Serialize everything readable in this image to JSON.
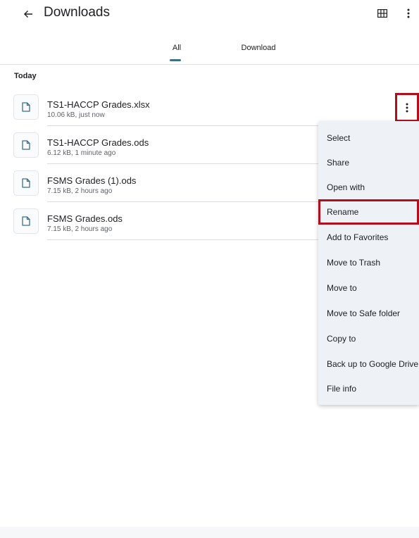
{
  "appbar": {
    "title": "Downloads",
    "back_icon": "arrow-left-icon",
    "grid_icon": "grid-view-icon",
    "more_icon": "more-vert-icon"
  },
  "tabs": [
    {
      "label": "All",
      "selected": true
    },
    {
      "label": "Download",
      "selected": false
    }
  ],
  "section": {
    "label": "Today"
  },
  "files": [
    {
      "name": "TS1-HACCP Grades.xlsx",
      "meta": "10.06 kB, just now"
    },
    {
      "name": "TS1-HACCP Grades.ods",
      "meta": "6.12 kB, 1 minute ago"
    },
    {
      "name": "FSMS Grades (1).ods",
      "meta": "7.15 kB, 2 hours ago"
    },
    {
      "name": "FSMS Grades.ods",
      "meta": "7.15 kB, 2 hours ago"
    }
  ],
  "context_menu": {
    "items": [
      {
        "label": "Select"
      },
      {
        "label": "Share"
      },
      {
        "label": "Open with"
      },
      {
        "label": "Rename",
        "highlighted": true
      },
      {
        "label": "Add to Favorites"
      },
      {
        "label": "Move to Trash"
      },
      {
        "label": "Move to"
      },
      {
        "label": "Move to Safe folder"
      },
      {
        "label": "Copy to"
      },
      {
        "label": "Back up to Google Drive"
      },
      {
        "label": "File info"
      }
    ]
  },
  "colors": {
    "accent": "#3f6e8a",
    "highlight_box": "#b0101e",
    "menu_bg": "#eef1f6"
  }
}
